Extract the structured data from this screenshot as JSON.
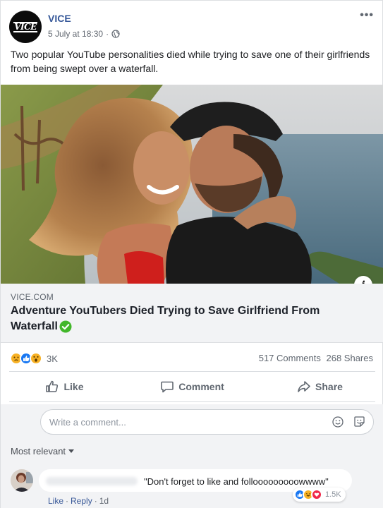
{
  "post": {
    "page_name": "VICE",
    "avatar_text": "VICE",
    "timestamp": "5 July at 18:30",
    "separator": "·",
    "more_glyph": "•••",
    "text": "Two popular YouTube personalities died while trying to save one of their girlfriends from being swept over a waterfall.",
    "info_glyph": "i"
  },
  "link": {
    "domain": "VICE.COM",
    "title": "Adventure YouTubers Died Trying to Save Girlfriend From Waterfall"
  },
  "stats": {
    "reaction_count": "3K",
    "comments": "517 Comments",
    "shares": "268 Shares"
  },
  "actions": {
    "like": "Like",
    "comment": "Comment",
    "share": "Share"
  },
  "composer": {
    "placeholder": "Write a comment..."
  },
  "sort": {
    "label": "Most relevant"
  },
  "comment": {
    "text": "\"Don't forget to like and follooooooooowwww\"",
    "reaction_count": "1.5K",
    "like": "Like",
    "reply": "Reply",
    "time": "1d",
    "dot": "·"
  },
  "colors": {
    "link_blue": "#365899",
    "facebook_blue": "#1877f2",
    "verified_green": "#42b72a",
    "reaction_yellow": "#f7b125"
  }
}
